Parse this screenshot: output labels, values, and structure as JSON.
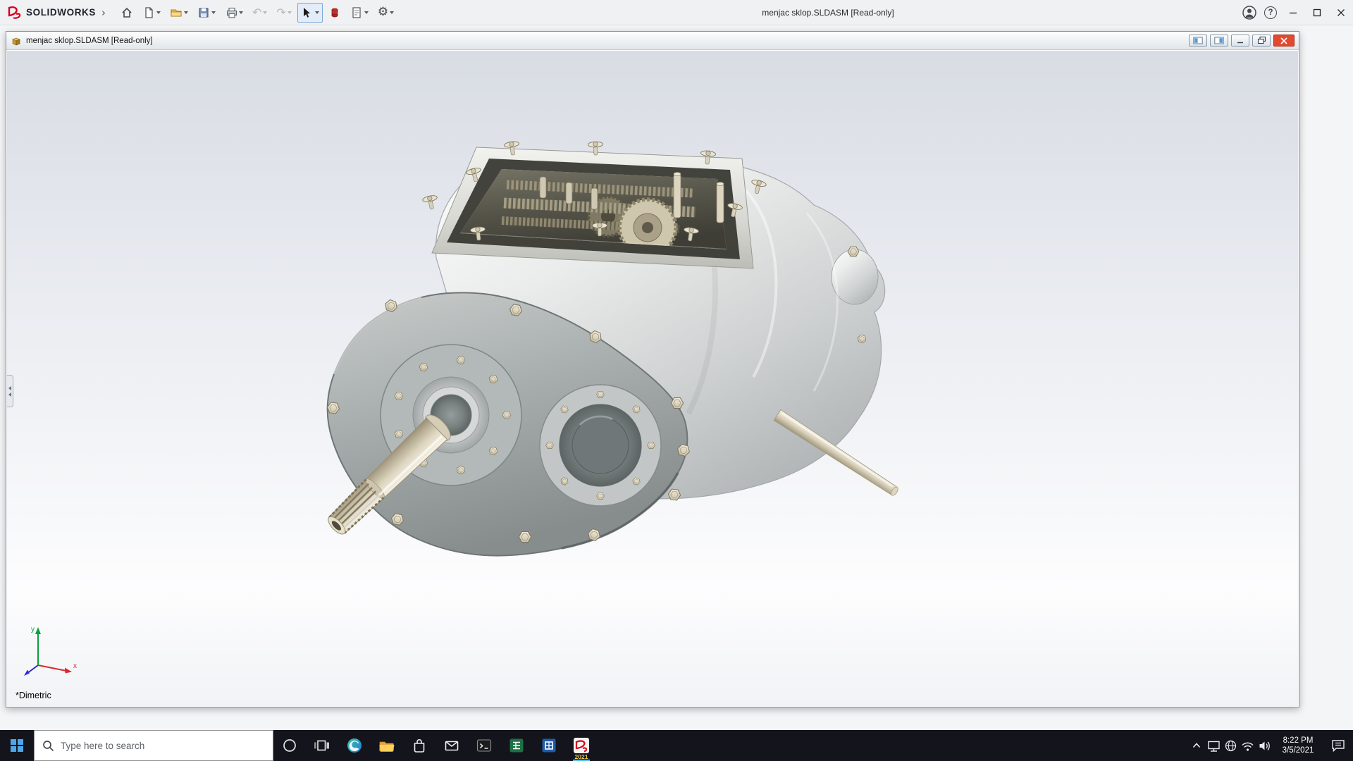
{
  "app": {
    "brand": "SOLIDWORKS",
    "title": "menjac sklop.SLDASM [Read-only]",
    "glyphs": {
      "menu_chevron": "›",
      "undo": "↶",
      "redo": "↷",
      "options_gear": "⚙",
      "help": "?"
    },
    "toolbar_items": [
      "home",
      "new-document",
      "open",
      "save",
      "print",
      "undo",
      "redo",
      "select",
      "red-tool",
      "file-properties",
      "options"
    ]
  },
  "document": {
    "title": "menjac sklop.SLDASM [Read-only]",
    "view_orientation": "*Dimetric",
    "triad": {
      "x": "x",
      "y": "y"
    }
  },
  "taskbar": {
    "search_placeholder": "Type here to search",
    "items": [
      "start",
      "search",
      "cortana",
      "task-view",
      "edge",
      "file-explorer",
      "store",
      "mail",
      "terminal",
      "green-app",
      "blue-app",
      "solidworks-2021"
    ],
    "solidworks_year": "2021",
    "clock": {
      "time": "8:22 PM",
      "date": "3/5/2021"
    }
  },
  "colors": {
    "brand_red": "#d6001c",
    "taskbar_bg": "#14141d",
    "close_red": "#e2492f",
    "accent_blue": "#4da6e8"
  }
}
